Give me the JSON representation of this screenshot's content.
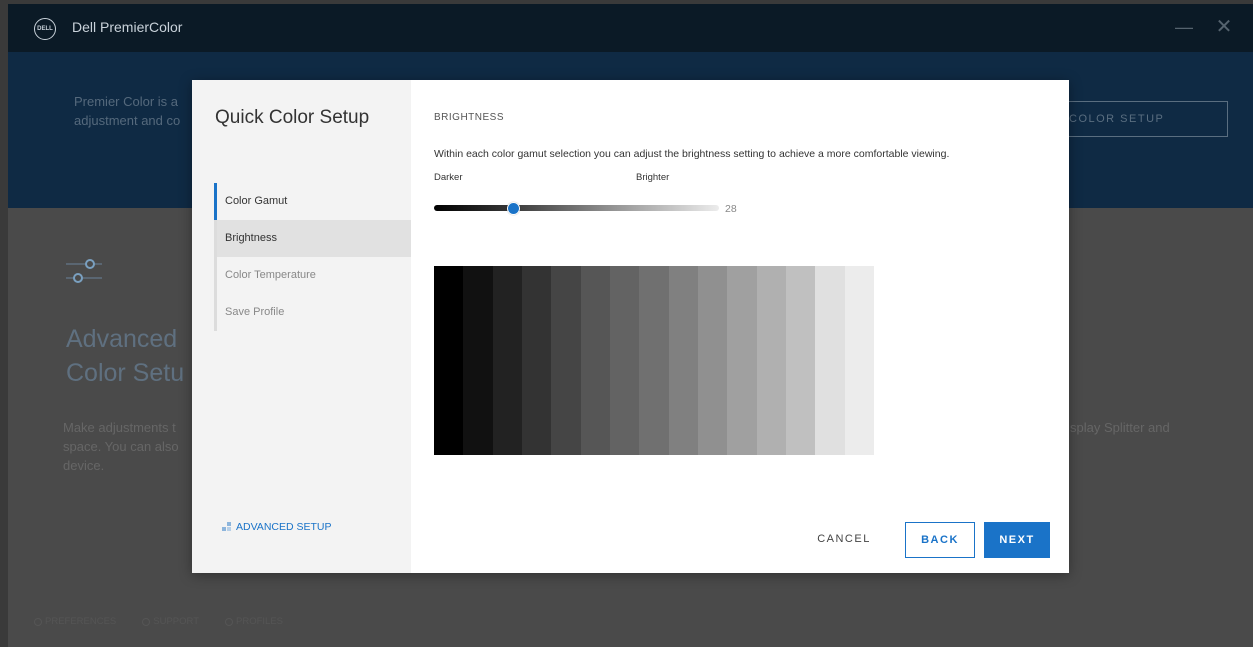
{
  "app": {
    "logo_text": "DELL",
    "title": "Dell PremierColor",
    "minimize_glyph": "—",
    "close_glyph": "✕"
  },
  "hero": {
    "line1": "Premier Color is a",
    "line2": "adjustment and co",
    "button_label": "COLOR SETUP"
  },
  "background": {
    "heading_line1": "Advanced",
    "heading_line2": "Color Setu",
    "desc_line1": "Make adjustments t",
    "desc_line2": "space. You can also",
    "desc_line3": "device.",
    "desc_right": "splay Splitter and"
  },
  "bottom_links": {
    "preferences": "PREFERENCES",
    "support": "SUPPORT",
    "profiles": "PROFILES"
  },
  "dialog": {
    "title": "Quick Color Setup",
    "steps": [
      {
        "label": "Color Gamut",
        "state": "done"
      },
      {
        "label": "Brightness",
        "state": "active"
      },
      {
        "label": "Color Temperature",
        "state": "pending"
      },
      {
        "label": "Save Profile",
        "state": "pending"
      }
    ],
    "advanced_setup": "ADVANCED SETUP",
    "section_label": "BRIGHTNESS",
    "description": "Within each color gamut selection you can adjust the brightness setting to achieve a more comfortable viewing.",
    "label_darker": "Darker",
    "label_brighter": "Brighter",
    "brightness_value": "28",
    "brightness_fraction": 0.28,
    "grayscale_colors": [
      "#000000",
      "#111111",
      "#222222",
      "#333333",
      "#454545",
      "#565656",
      "#636363",
      "#707070",
      "#808080",
      "#909090",
      "#a0a0a0",
      "#b0b0b0",
      "#c0c0c0",
      "#e0e0e0",
      "#ececec"
    ],
    "buttons": {
      "cancel": "CANCEL",
      "back": "BACK",
      "next": "NEXT"
    }
  },
  "colors": {
    "accent": "#1a73c8",
    "titlebar": "#0b1a26",
    "hero": "#0f2a44"
  }
}
